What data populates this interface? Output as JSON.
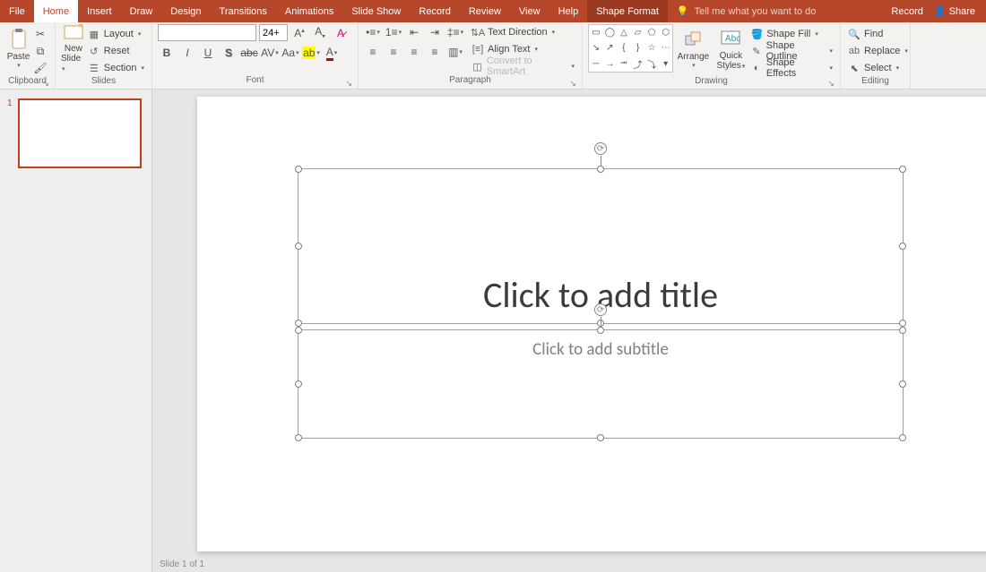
{
  "tabs": {
    "file": "File",
    "home": "Home",
    "insert": "Insert",
    "draw": "Draw",
    "design": "Design",
    "transitions": "Transitions",
    "animations": "Animations",
    "slideshow": "Slide Show",
    "record": "Record",
    "review": "Review",
    "view": "View",
    "help": "Help",
    "shapeformat": "Shape Format"
  },
  "tellme": "Tell me what you want to do",
  "title_right": {
    "record": "Record",
    "share": "Share"
  },
  "clipboard": {
    "label": "Clipboard",
    "paste": "Paste"
  },
  "slides": {
    "label": "Slides",
    "new_slide_line1": "New",
    "new_slide_line2": "Slide",
    "layout": "Layout",
    "reset": "Reset",
    "section": "Section"
  },
  "font": {
    "label": "Font",
    "size": "24+"
  },
  "paragraph": {
    "label": "Paragraph",
    "text_direction": "Text Direction",
    "align_text": "Align Text",
    "smartart": "Convert to SmartArt"
  },
  "drawing": {
    "label": "Drawing",
    "arrange": "Arrange",
    "quick_line1": "Quick",
    "quick_line2": "Styles",
    "fill": "Shape Fill",
    "outline": "Shape Outline",
    "effects": "Shape Effects"
  },
  "editing": {
    "label": "Editing",
    "find": "Find",
    "replace": "Replace",
    "select": "Select"
  },
  "slide": {
    "num": "1",
    "title_placeholder": "Click to add title",
    "subtitle_placeholder": "Click to add subtitle"
  },
  "status": "Slide 1 of 1"
}
